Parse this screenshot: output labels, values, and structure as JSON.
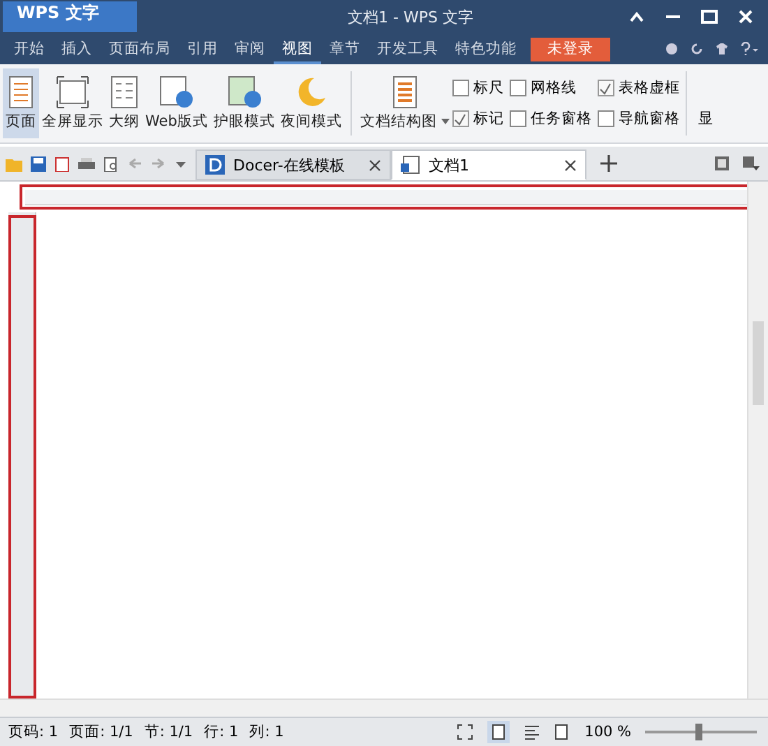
{
  "app_button": {
    "label": "WPS 文字"
  },
  "window": {
    "title": "文档1 - WPS 文字"
  },
  "menu": [
    {
      "label": "开始",
      "selected": false
    },
    {
      "label": "插入",
      "selected": false
    },
    {
      "label": "页面布局",
      "selected": false
    },
    {
      "label": "引用",
      "selected": false
    },
    {
      "label": "审阅",
      "selected": false
    },
    {
      "label": "视图",
      "selected": true
    },
    {
      "label": "章节",
      "selected": false
    },
    {
      "label": "开发工具",
      "selected": false
    },
    {
      "label": "特色功能",
      "selected": false
    }
  ],
  "login_button": "未登录",
  "ribbon_buttons": [
    {
      "label": "页面",
      "selected": true,
      "kind": "page"
    },
    {
      "label": "全屏显示",
      "selected": false,
      "kind": "full"
    },
    {
      "label": "大纲",
      "selected": false,
      "kind": "outline"
    },
    {
      "label": "Web版式",
      "selected": false,
      "kind": "web"
    },
    {
      "label": "护眼模式",
      "selected": false,
      "kind": "eye"
    },
    {
      "label": "夜间模式",
      "selected": false,
      "kind": "night"
    }
  ],
  "doc_map_button": "文档结构图",
  "checkboxes": [
    {
      "label": "标尺",
      "checked": false
    },
    {
      "label": "网格线",
      "checked": false
    },
    {
      "label": "表格虚框",
      "checked": true
    },
    {
      "label": "标记",
      "checked": true
    },
    {
      "label": "任务窗格",
      "checked": false
    },
    {
      "label": "导航窗格",
      "checked": false
    }
  ],
  "cut_button": "显",
  "doc_tabs": [
    {
      "label": "Docer-在线模板",
      "selected": false,
      "kind": "docer"
    },
    {
      "label": "文档1",
      "selected": true,
      "kind": "doc"
    }
  ],
  "status_bar": [
    "页码: 1",
    "页面: 1/1",
    "节: 1/1",
    "行: 1",
    "列: 1"
  ],
  "zoom": {
    "reading": "100 %",
    "level": 0.45
  }
}
